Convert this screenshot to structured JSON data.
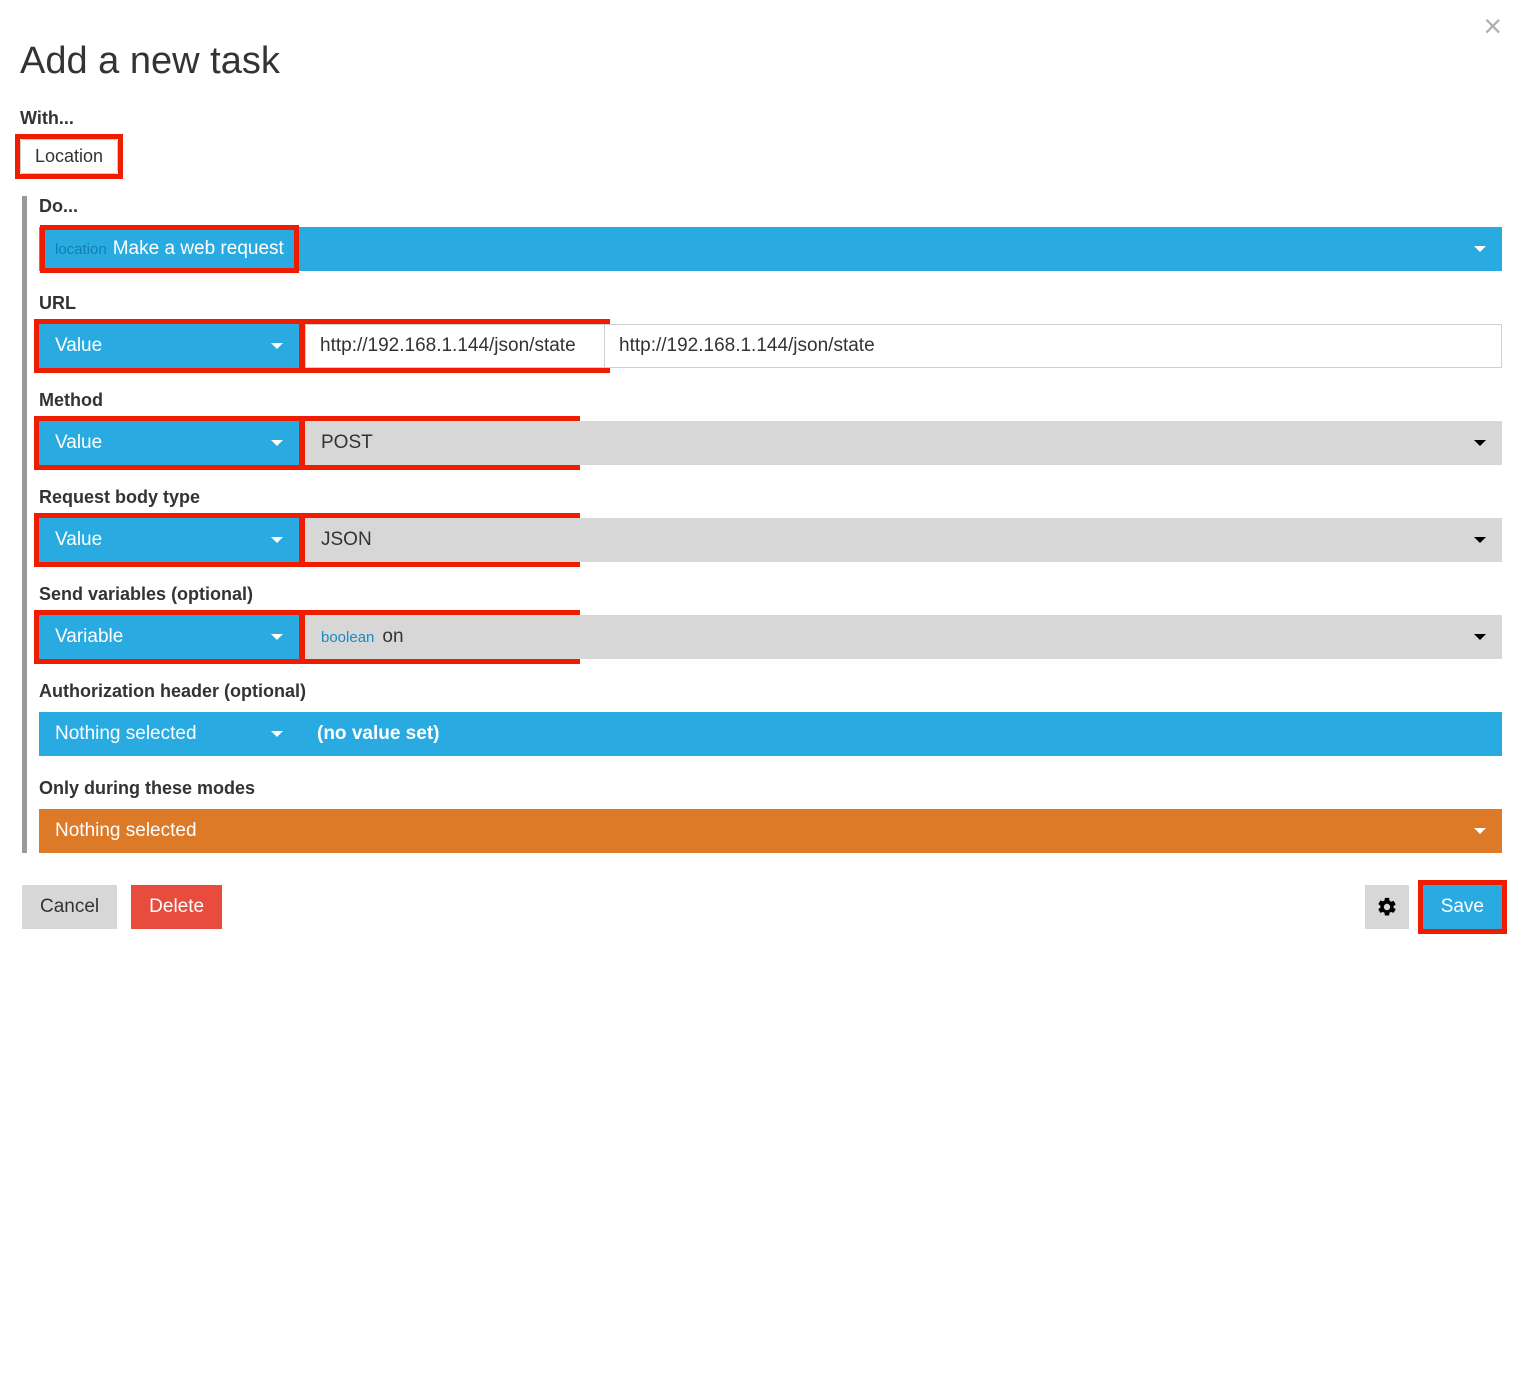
{
  "modal": {
    "title": "Add a new task",
    "close_symbol": "×"
  },
  "with": {
    "label": "With...",
    "chip": "Location"
  },
  "do": {
    "label": "Do...",
    "prefix": "location",
    "action": "Make a web request"
  },
  "url": {
    "label": "URL",
    "type_selector": "Value",
    "value": "http://192.168.1.144/json/state"
  },
  "method": {
    "label": "Method",
    "type_selector": "Value",
    "value": "POST"
  },
  "body_type": {
    "label": "Request body type",
    "type_selector": "Value",
    "value": "JSON"
  },
  "send_vars": {
    "label": "Send variables (optional)",
    "type_selector": "Variable",
    "var_type": "boolean",
    "var_name": "on"
  },
  "auth": {
    "label": "Authorization header (optional)",
    "type_selector": "Nothing selected",
    "no_value": "(no value set)"
  },
  "modes": {
    "label": "Only during these modes",
    "value": "Nothing selected"
  },
  "footer": {
    "cancel": "Cancel",
    "delete": "Delete",
    "save": "Save"
  }
}
